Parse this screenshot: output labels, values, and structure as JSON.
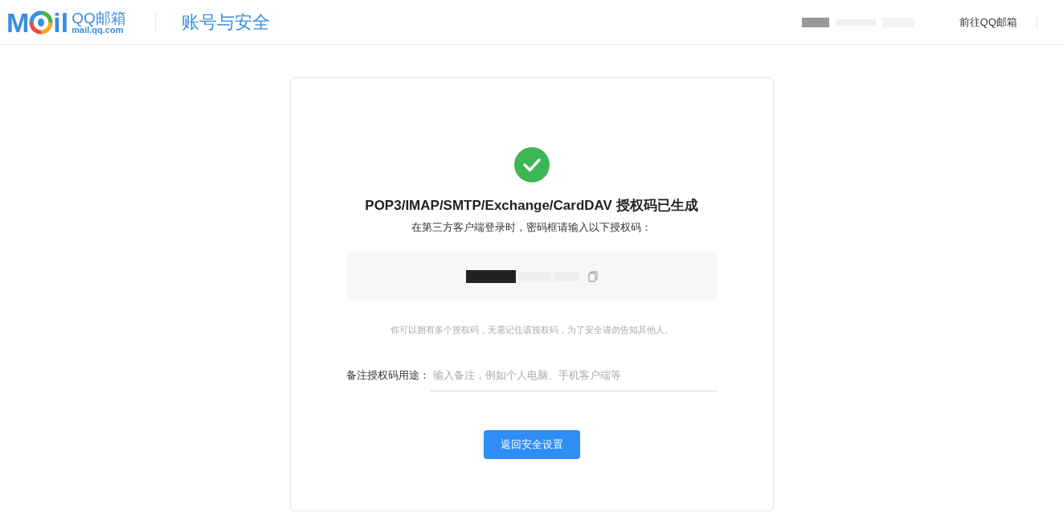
{
  "header": {
    "logo": {
      "first": "M",
      "last": "il",
      "brand": "QQ邮箱",
      "domain": "mail.qq.com"
    },
    "title": "账号与安全",
    "link": "前往QQ邮箱"
  },
  "card": {
    "title": "POP3/IMAP/SMTP/Exchange/CardDAV 授权码已生成",
    "subtitle": "在第三方客户端登录时，密码框请输入以下授权码：",
    "note": "你可以拥有多个授权码，无需记住该授权码，为了安全请勿告知其他人。",
    "remark": {
      "label": "备注授权码用途：",
      "placeholder": "输入备注，例如个人电脑、手机客户端等"
    },
    "button": "返回安全设置"
  }
}
